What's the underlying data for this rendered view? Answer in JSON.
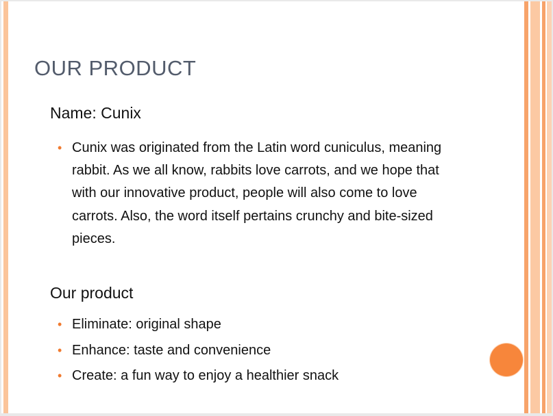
{
  "slide": {
    "title": "OUR PRODUCT",
    "section1": {
      "heading": "Name: Cunix",
      "bullets": [
        "Cunix was originated from the Latin word cuniculus, meaning rabbit. As we all know, rabbits love carrots, and we hope that with our innovative product, people will also come to love carrots. Also, the word itself pertains crunchy and bite-sized pieces."
      ]
    },
    "section2": {
      "heading": "Our product",
      "bullets": [
        "Eliminate: original shape",
        "Enhance: taste and convenience",
        "Create: a fun way to enjoy a healthier snack"
      ]
    },
    "bullet_glyph": "•"
  },
  "colors": {
    "accent_orange": "#f7863b",
    "title_gray": "#525b6b",
    "stripe_peach": "#fbc49a"
  },
  "icons": {
    "bullet": "bullet-dot-icon",
    "decoration": "orange-circle"
  }
}
